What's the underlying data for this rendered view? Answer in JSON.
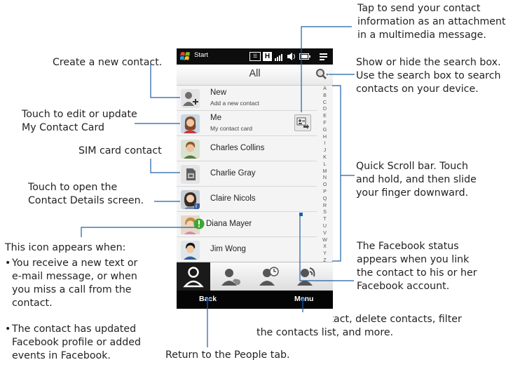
{
  "phone": {
    "status_bar": {
      "start_label": "Start",
      "h_indicator": "H"
    },
    "title": "All",
    "contacts": [
      {
        "name": "New",
        "detail": "Add a new contact",
        "icon": "add-contact-icon"
      },
      {
        "name": "Me",
        "detail": "My contact card",
        "icon": "me-avatar"
      },
      {
        "name": "Charles Collins",
        "icon": "contact-photo"
      },
      {
        "name": "Charlie Gray",
        "icon": "sim-card-icon"
      },
      {
        "name": "Claire Nicols",
        "icon": "contact-photo"
      },
      {
        "name": "Diana Mayer",
        "icon": "contact-photo"
      },
      {
        "name": "Jim Wong",
        "icon": "contact-photo"
      }
    ],
    "alphabet": [
      "A",
      "B",
      "C",
      "D",
      "E",
      "F",
      "G",
      "H",
      "I",
      "J",
      "K",
      "L",
      "M",
      "N",
      "O",
      "P",
      "Q",
      "R",
      "S",
      "T",
      "U",
      "V",
      "W",
      "X",
      "Y",
      "Z"
    ],
    "tabs": [
      "people-tab",
      "facebook-updates-tab",
      "contact-history-tab",
      "call-history-tab"
    ],
    "softkeys": {
      "left": "Back",
      "right": "Menu"
    }
  },
  "callouts": {
    "send_contact": [
      "Tap to send your contact",
      "information as an attachment",
      "in a multimedia message."
    ],
    "search": [
      "Show or hide the search box.",
      "Use the search box to search",
      "contacts on your device."
    ],
    "create": [
      "Create a new contact."
    ],
    "edit_my_card": [
      "Touch to edit or update",
      "My Contact Card"
    ],
    "sim": [
      "SIM card contact"
    ],
    "details": [
      "Touch to open the",
      "Contact Details screen."
    ],
    "quick_scroll": [
      "Quick Scroll bar. Touch",
      "and hold, and then slide",
      "your finger downward."
    ],
    "icon_appears": "This icon appears when:",
    "icon_bullets": [
      [
        "You receive a new text or",
        "e-mail message, or when",
        "you miss a call from the",
        "contact."
      ],
      [
        "The contact has updated",
        "Facebook profile or added",
        "events in Facebook."
      ]
    ],
    "facebook_status": [
      "The Facebook status",
      "appears when you link",
      "the contact to his or her",
      "Facebook account."
    ],
    "menu": [
      "Add a new contact, delete contacts, filter",
      "the contacts list, and more."
    ],
    "back": [
      "Return to the People tab."
    ]
  },
  "colors": {
    "callout_line": "#1f5fa8",
    "text": "#231f20",
    "status_bar": "#0d0d0d",
    "green_badge": "#3aa832"
  }
}
